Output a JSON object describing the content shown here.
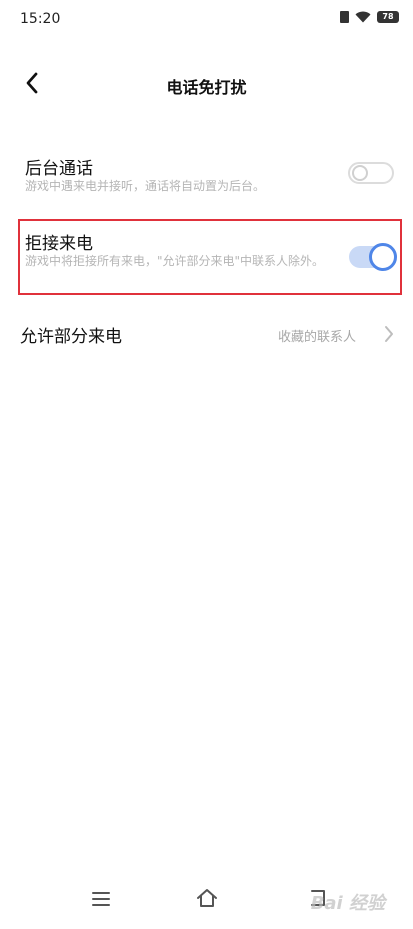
{
  "status_bar": {
    "time": "15:20",
    "battery": "78"
  },
  "header": {
    "title": "电话免打扰"
  },
  "settings": [
    {
      "title": "后台通话",
      "description": "游戏中遇来电并接听，通话将自动置为后台。",
      "enabled": false
    },
    {
      "title": "拒接来电",
      "description": "游戏中将拒接所有来电，\"允许部分来电\"中联系人除外。",
      "enabled": true
    }
  ],
  "allow_calls": {
    "title": "允许部分来电",
    "value": "收藏的联系人"
  },
  "colors": {
    "accent": "#4f86e8",
    "highlight": "#e0313b"
  },
  "watermark": "Bai 经验"
}
